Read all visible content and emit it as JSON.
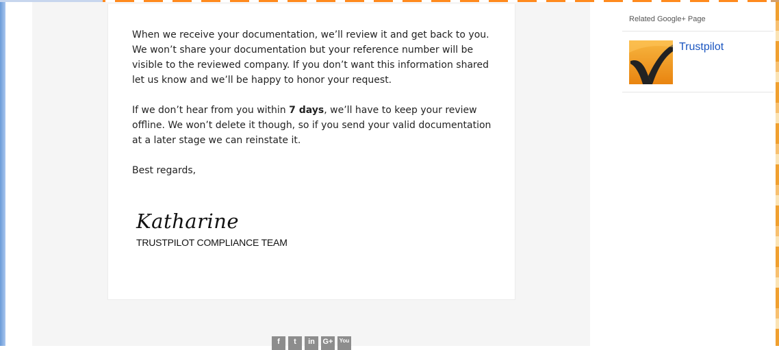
{
  "email": {
    "paragraph1": "When we receive your documentation, we’ll review it and get back to you. We won’t share your documentation but your reference number will be visible to the reviewed company. If you don’t want this information shared let us know and we’ll be happy to honor your request.",
    "paragraph2_before": "If we don’t hear from you within ",
    "paragraph2_bold": "7 days",
    "paragraph2_after": ", we’ll have to keep your review offline. We won’t delete it though, so if you send your valid documentation at a later stage we can reinstate it.",
    "closing": "Best regards,",
    "signature": "Katharine",
    "team": "TRUSTPILOT COMPLIANCE TEAM"
  },
  "social": [
    {
      "icon": "facebook-icon",
      "glyph": "f"
    },
    {
      "icon": "twitter-icon",
      "glyph": "t"
    },
    {
      "icon": "linkedin-icon",
      "glyph": "in"
    },
    {
      "icon": "google-plus-icon",
      "glyph": "G+"
    },
    {
      "icon": "youtube-icon",
      "glyph": "You"
    }
  ],
  "sidebar": {
    "label": "Related Google+ Page",
    "page_name": "Trustpilot"
  },
  "colors": {
    "link": "#1a55c0",
    "brand_orange": "#f39a1e",
    "email_background": "#f5f5f5"
  }
}
